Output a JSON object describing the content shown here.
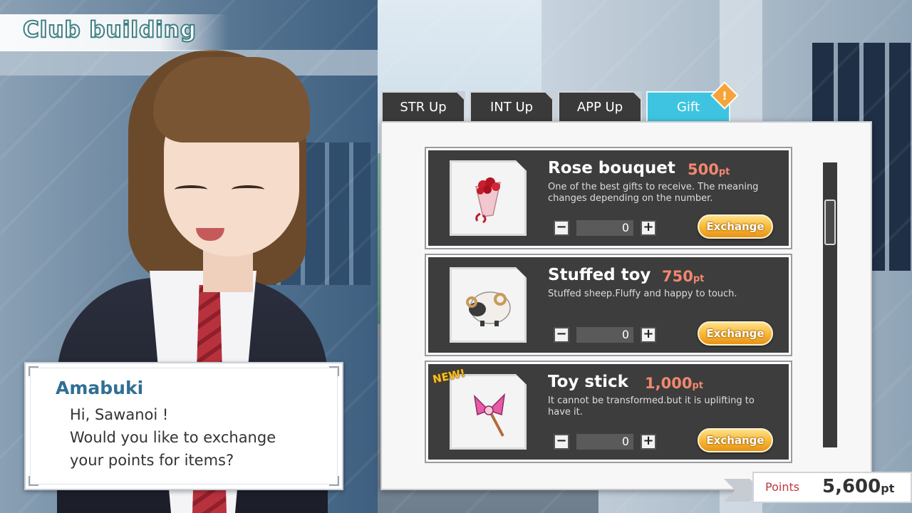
{
  "location": {
    "title": "Club building"
  },
  "tabs": [
    {
      "label": "STR Up",
      "active": false
    },
    {
      "label": "INT Up",
      "active": false
    },
    {
      "label": "APP Up",
      "active": false
    },
    {
      "label": "Gift",
      "active": true,
      "alert": "!"
    }
  ],
  "shop": {
    "items": [
      {
        "name": "Rose bouquet",
        "price": "500",
        "price_unit": "pt",
        "description": "One of the best gifts to receive. The meaning changes depending on the number.",
        "quantity": "0",
        "exchange_label": "Exchange",
        "icon": "rose-bouquet-icon"
      },
      {
        "name": "Stuffed toy",
        "price": "750",
        "price_unit": "pt",
        "description": "Stuffed sheep.Fluffy and happy to touch.",
        "quantity": "0",
        "exchange_label": "Exchange",
        "icon": "stuffed-sheep-icon"
      },
      {
        "name": "Toy stick",
        "price": "1,000",
        "price_unit": "pt",
        "description": "It cannot be transformed.but it is uplifting to have it.",
        "quantity": "0",
        "exchange_label": "Exchange",
        "badge": "NEW!",
        "icon": "toy-stick-icon"
      }
    ],
    "minus_symbol": "−",
    "plus_symbol": "+"
  },
  "dialog": {
    "speaker": "Amabuki",
    "lines": [
      "Hi, Sawanoi !",
      "Would you like to exchange",
      "your points for items?"
    ]
  },
  "points": {
    "label": "Points",
    "value": "5,600",
    "unit": "pt"
  },
  "colors": {
    "accent_tab": "#3ec4e0",
    "price": "#f2876f",
    "exchange_button": "#f7b632",
    "speaker_name": "#2f6f93"
  }
}
